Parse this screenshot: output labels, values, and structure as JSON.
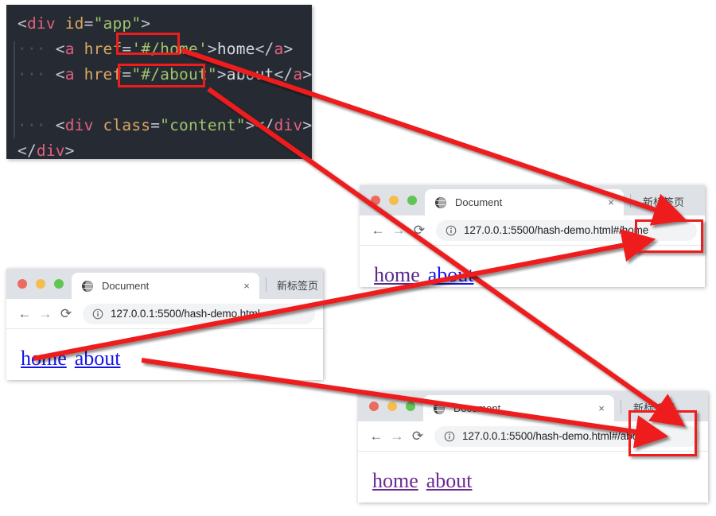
{
  "code_editor": {
    "name": "html-source-snippet",
    "background": "#262b33",
    "lines": [
      {
        "indent": 0,
        "parts": [
          {
            "t": "<",
            "c": "punc"
          },
          {
            "t": "div",
            "c": "tag"
          },
          {
            "t": " ",
            "c": "text"
          },
          {
            "t": "id",
            "c": "attr"
          },
          {
            "t": "=",
            "c": "punc"
          },
          {
            "t": "\"app\"",
            "c": "str"
          },
          {
            "t": ">",
            "c": "punc"
          }
        ]
      },
      {
        "indent": 1,
        "parts": [
          {
            "t": "<",
            "c": "punc"
          },
          {
            "t": "a",
            "c": "tag"
          },
          {
            "t": " ",
            "c": "text"
          },
          {
            "t": "href",
            "c": "attr"
          },
          {
            "t": "=",
            "c": "punc"
          },
          {
            "t": "'#/home'",
            "c": "str"
          },
          {
            "t": ">",
            "c": "punc"
          },
          {
            "t": "home",
            "c": "text"
          },
          {
            "t": "</",
            "c": "punc"
          },
          {
            "t": "a",
            "c": "tag"
          },
          {
            "t": ">",
            "c": "punc"
          }
        ]
      },
      {
        "indent": 1,
        "parts": [
          {
            "t": "<",
            "c": "punc"
          },
          {
            "t": "a",
            "c": "tag"
          },
          {
            "t": " ",
            "c": "text"
          },
          {
            "t": "href",
            "c": "attr"
          },
          {
            "t": "=",
            "c": "punc"
          },
          {
            "t": "\"#/about\"",
            "c": "str"
          },
          {
            "t": ">",
            "c": "punc"
          },
          {
            "t": "about",
            "c": "text"
          },
          {
            "t": "</",
            "c": "punc"
          },
          {
            "t": "a",
            "c": "tag"
          },
          {
            "t": ">",
            "c": "punc"
          }
        ]
      },
      {
        "indent": 0,
        "parts": []
      },
      {
        "indent": 1,
        "parts": [
          {
            "t": "<",
            "c": "punc"
          },
          {
            "t": "div",
            "c": "tag"
          },
          {
            "t": " ",
            "c": "text"
          },
          {
            "t": "class",
            "c": "attr"
          },
          {
            "t": "=",
            "c": "punc"
          },
          {
            "t": "\"content\"",
            "c": "str"
          },
          {
            "t": ">",
            "c": "punc"
          },
          {
            "t": "</",
            "c": "punc"
          },
          {
            "t": "div",
            "c": "tag"
          },
          {
            "t": ">",
            "c": "punc"
          }
        ]
      },
      {
        "indent": 0,
        "parts": [
          {
            "t": "</",
            "c": "punc"
          },
          {
            "t": "div",
            "c": "tag"
          },
          {
            "t": ">",
            "c": "punc"
          }
        ]
      }
    ]
  },
  "browsers": [
    {
      "id": "browser-home",
      "tab_title": "Document",
      "close_label": "×",
      "new_tab_label": "新标签页",
      "url_base": "127.0.0.1:5500/hash-demo.htm",
      "url_hash": "l#/home",
      "links": [
        {
          "label": "home",
          "state": "mixed"
        },
        {
          "label": "about",
          "state": "blue"
        }
      ]
    },
    {
      "id": "browser-plain",
      "tab_title": "Document",
      "close_label": "×",
      "new_tab_label": "新标签页",
      "url_base": "127.0.0.1:5500/hash-demo.html",
      "url_hash": "",
      "links": [
        {
          "label": "home",
          "state": "blue"
        },
        {
          "label": "about",
          "state": "blue"
        }
      ]
    },
    {
      "id": "browser-about",
      "tab_title": "Document",
      "close_label": "×",
      "new_tab_label": "新标签页",
      "url_base": "127.0.0.1:5500/hash-demo.htm",
      "url_hash": "l#/about",
      "links": [
        {
          "label": "home",
          "state": "visited"
        },
        {
          "label": "about",
          "state": "visited"
        }
      ]
    }
  ],
  "annotations": {
    "highlight_color": "#ee1c1c",
    "boxes": [
      {
        "name": "highlight-href-home",
        "label": "#/home"
      },
      {
        "name": "highlight-href-about",
        "label": "#/about"
      },
      {
        "name": "highlight-url-hash-home",
        "label": "#/home"
      },
      {
        "name": "highlight-url-hash-about",
        "label": "#/about"
      }
    ],
    "arrows": [
      {
        "name": "arrow-href-home-to-url-home",
        "from": "#/home attribute",
        "to": "#/home in address bar"
      },
      {
        "name": "arrow-href-about-to-url-about",
        "from": "#/about attribute",
        "to": "#/about in address bar"
      },
      {
        "name": "arrow-link-home-to-url-home",
        "from": "home link",
        "to": "#/home in address bar"
      },
      {
        "name": "arrow-link-about-to-url-about",
        "from": "about link",
        "to": "#/about in address bar"
      }
    ]
  }
}
